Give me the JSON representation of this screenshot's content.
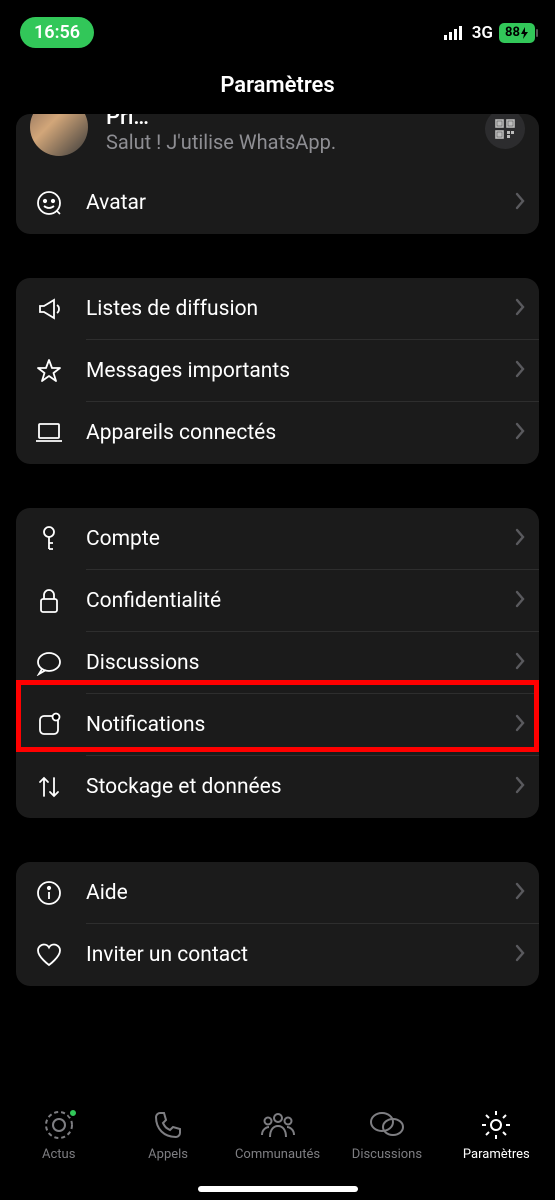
{
  "status": {
    "time": "16:56",
    "network": "3G",
    "battery": "88"
  },
  "header": {
    "title": "Paramètres"
  },
  "profile": {
    "name": "Pri…",
    "status_text": "Salut ! J'utilise WhatsApp.",
    "avatar_row": "Avatar"
  },
  "group1": {
    "broadcast": "Listes de diffusion",
    "starred": "Messages importants",
    "linked": "Appareils connectés"
  },
  "group2": {
    "account": "Compte",
    "privacy": "Confidentialité",
    "chats": "Discussions",
    "notifications": "Notifications",
    "storage": "Stockage et données"
  },
  "group3": {
    "help": "Aide",
    "invite": "Inviter un contact"
  },
  "tabs": {
    "updates": "Actus",
    "calls": "Appels",
    "communities": "Communautés",
    "chats": "Discussions",
    "settings": "Paramètres"
  }
}
